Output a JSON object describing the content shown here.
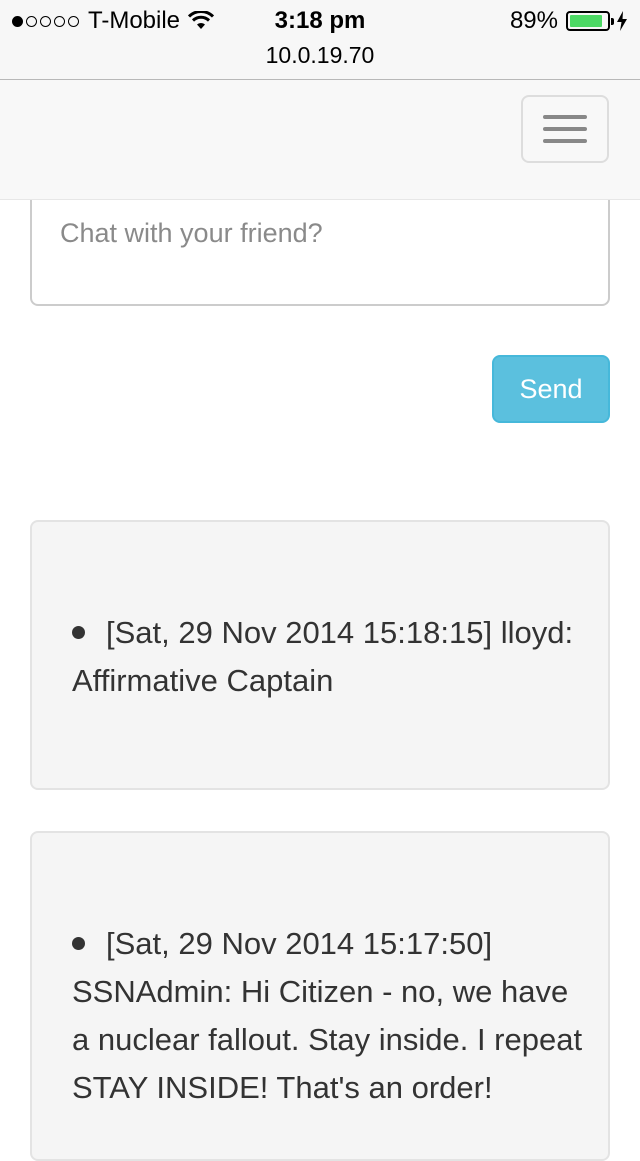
{
  "status_bar": {
    "signal_dots_filled": 1,
    "signal_dots_total": 5,
    "carrier": "T-Mobile",
    "time": "3:18 pm",
    "url": "10.0.19.70",
    "battery_percent_label": "89%",
    "battery_level": 0.89,
    "battery_color": "#4cd964",
    "wifi_icon": "wifi-icon",
    "charging_icon": "charging-bolt-icon"
  },
  "navbar": {
    "menu_icon": "hamburger-menu-icon"
  },
  "chat": {
    "placeholder": "Chat with your friend?",
    "value": "",
    "send_label": "Send",
    "send_color": "#5bc0de"
  },
  "messages": [
    {
      "timestamp": "[Sat, 29 Nov 2014 15:18:15]",
      "text": "lloyd: Affirmative Captain"
    },
    {
      "timestamp": "[Sat, 29 Nov 2014 15:17:50]",
      "text": "SSNAdmin: Hi Citizen - no, we have a nuclear fallout. Stay inside. I repeat STAY INSIDE! That's an order!"
    }
  ]
}
